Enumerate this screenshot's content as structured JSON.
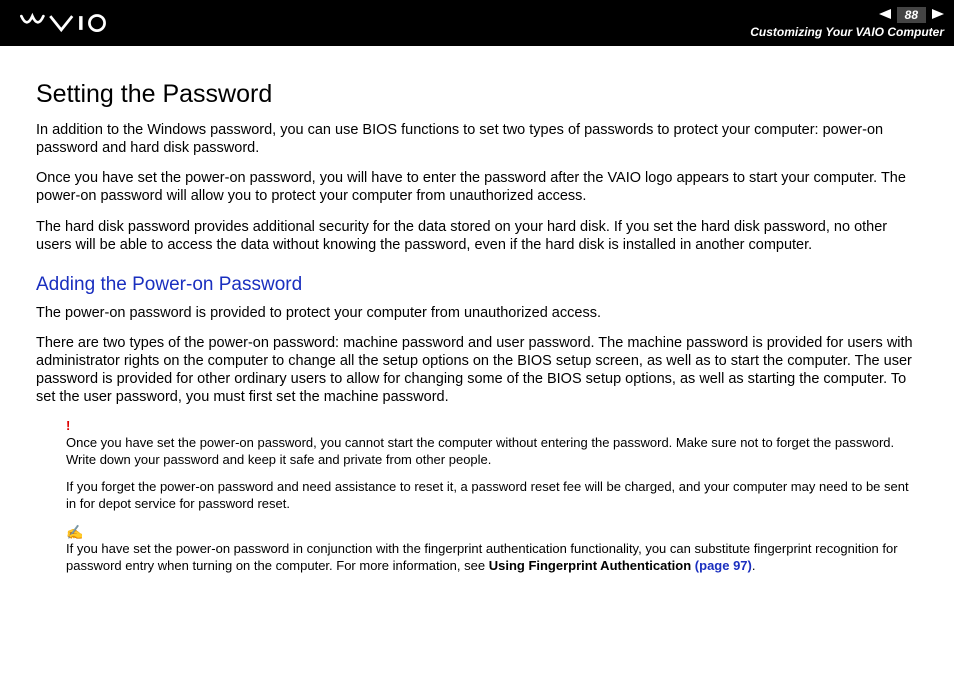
{
  "header": {
    "page_number": "88",
    "section": "Customizing Your VAIO Computer"
  },
  "main": {
    "title": "Setting the Password",
    "p1": "In addition to the Windows password, you can use BIOS functions to set two types of passwords to protect your computer: power-on password and hard disk password.",
    "p2": "Once you have set the power-on password, you will have to enter the password after the VAIO logo appears to start your computer. The power-on password will allow you to protect your computer from unauthorized access.",
    "p3": "The hard disk password provides additional security for the data stored on your hard disk. If you set the hard disk password, no other users will be able to access the data without knowing the password, even if the hard disk is installed in another computer.",
    "sub1": {
      "heading": "Adding the Power-on Password",
      "p1": "The power-on password is provided to protect your computer from unauthorized access.",
      "p2": "There are two types of the power-on password: machine password and user password. The machine password is provided for users with administrator rights on the computer to change all the setup options on the BIOS setup screen, as well as to start the computer. The user password is provided for other ordinary users to allow for changing some of the BIOS setup options, as well as starting the computer. To set the user password, you must first set the machine password."
    },
    "warning": {
      "icon": "!",
      "p1": "Once you have set the power-on password, you cannot start the computer without entering the password. Make sure not to forget the password. Write down your password and keep it safe and private from other people.",
      "p2": "If you forget the power-on password and need assistance to reset it, a password reset fee will be charged, and your computer may need to be sent in for depot service for password reset."
    },
    "info": {
      "icon": "✍",
      "text_pre": "If you have set the power-on password in conjunction with the fingerprint authentication functionality, you can substitute fingerprint recognition for password entry when turning on the computer. For more information, see ",
      "link_label": "Using Fingerprint Authentication ",
      "link_page": "(page 97)",
      "text_post": "."
    }
  }
}
